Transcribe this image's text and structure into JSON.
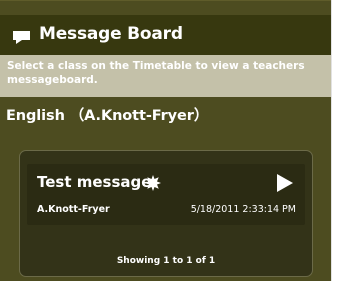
{
  "header": {
    "title": "Message Board",
    "icon": "message-icon"
  },
  "info": {
    "text": "Select a class on the Timetable to view a teachers messageboard."
  },
  "class_title": "English （A.Knott-Fryer）",
  "messages": [
    {
      "title": "Test message",
      "author": "A.Knott-Fryer",
      "date": "5/18/2011 2:33:14 PM",
      "new_icon": "new-burst-icon",
      "open_icon": "play-arrow-icon"
    }
  ],
  "pagination": {
    "text": "Showing 1 to 1 of 1"
  },
  "colors": {
    "background": "#4d4c20",
    "header": "#37380f",
    "info_bar": "#c4c1a9",
    "panel": "#333318",
    "message": "#2b2b13"
  }
}
